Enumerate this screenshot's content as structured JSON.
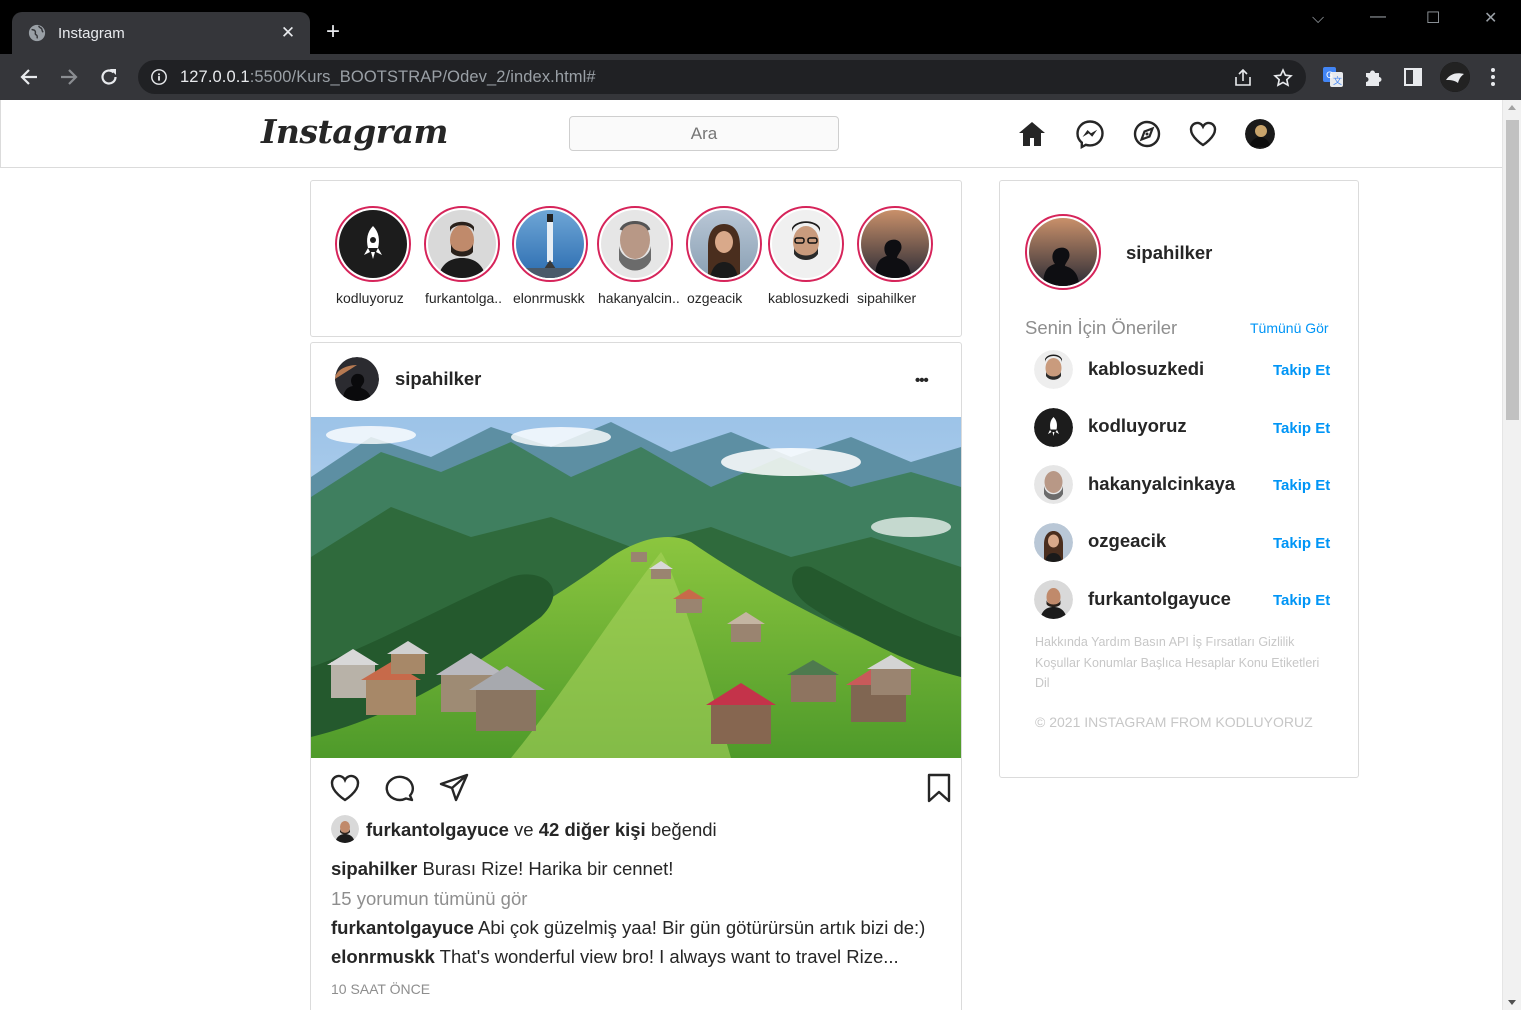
{
  "browser": {
    "tab_title": "Instagram",
    "tab_close": "✕",
    "new_tab": "+",
    "url_host": "127.0.0.1",
    "url_rest": ":5500/Kurs_BOOTSTRAP/Odev_2/index.html#",
    "window_controls": {
      "dropdown": "⌵",
      "minimize": "—",
      "maximize": "☐",
      "close": "✕"
    }
  },
  "header": {
    "logo": "Instagram",
    "search_placeholder": "Ara",
    "nav_icons": [
      "home-icon",
      "messenger-icon",
      "explore-compass-icon",
      "heart-icon",
      "profile-avatar"
    ]
  },
  "stories": [
    {
      "name": "kodluyoruz",
      "avatar": "rocket"
    },
    {
      "name": "furkantolga..",
      "avatar": "man-beard"
    },
    {
      "name": "elonrmuskk",
      "avatar": "rocket-launch"
    },
    {
      "name": "hakanyalcin..",
      "avatar": "grey-beard"
    },
    {
      "name": "ozgeacik",
      "avatar": "woman"
    },
    {
      "name": "kablosuzkedi",
      "avatar": "man-glasses"
    },
    {
      "name": "sipahilker",
      "avatar": "silhouette"
    }
  ],
  "post": {
    "username": "sipahilker",
    "more": "•••",
    "likes": {
      "user": "furkantolgayuce",
      "and": "ve",
      "count_text": "42 diğer kişi",
      "suffix": "beğendi"
    },
    "caption": {
      "user": "sipahilker",
      "text": "Burası Rize! Harika bir cennet!"
    },
    "view_comments": "15 yorumun tümünü gör",
    "comments": [
      {
        "user": "furkantolgayuce",
        "text": "Abi çok güzelmiş yaa! Bir gün götürürsün artık bizi de:)"
      },
      {
        "user": "elonrmuskk",
        "text": "That's wonderful view bro! I always want to travel Rize..."
      }
    ],
    "time": "10 SAAT ÖNCE"
  },
  "sidebar": {
    "profile_name": "sipahilker",
    "suggestions_title": "Senin İçin Öneriler",
    "see_all": "Tümünü Gör",
    "follow_label": "Takip Et",
    "suggestions": [
      {
        "name": "kablosuzkedi"
      },
      {
        "name": "kodluyoruz"
      },
      {
        "name": "hakanyalcinkaya"
      },
      {
        "name": "ozgeacik"
      },
      {
        "name": "furkantolgayuce"
      }
    ],
    "footer_links": [
      "Hakkında",
      "Yardım",
      "Basın",
      "API",
      "İş Fırsatları",
      "Gizlilik",
      "Koşullar",
      "Konumlar",
      "Başlıca Hesaplar",
      "Konu Etiketleri",
      "Dil"
    ],
    "copyright": "© 2021 INSTAGRAM FROM KODLUYORUZ"
  },
  "colors": {
    "story_ring": "#d6245a",
    "link_blue": "#0095f6",
    "border": "#dbdbdb"
  }
}
